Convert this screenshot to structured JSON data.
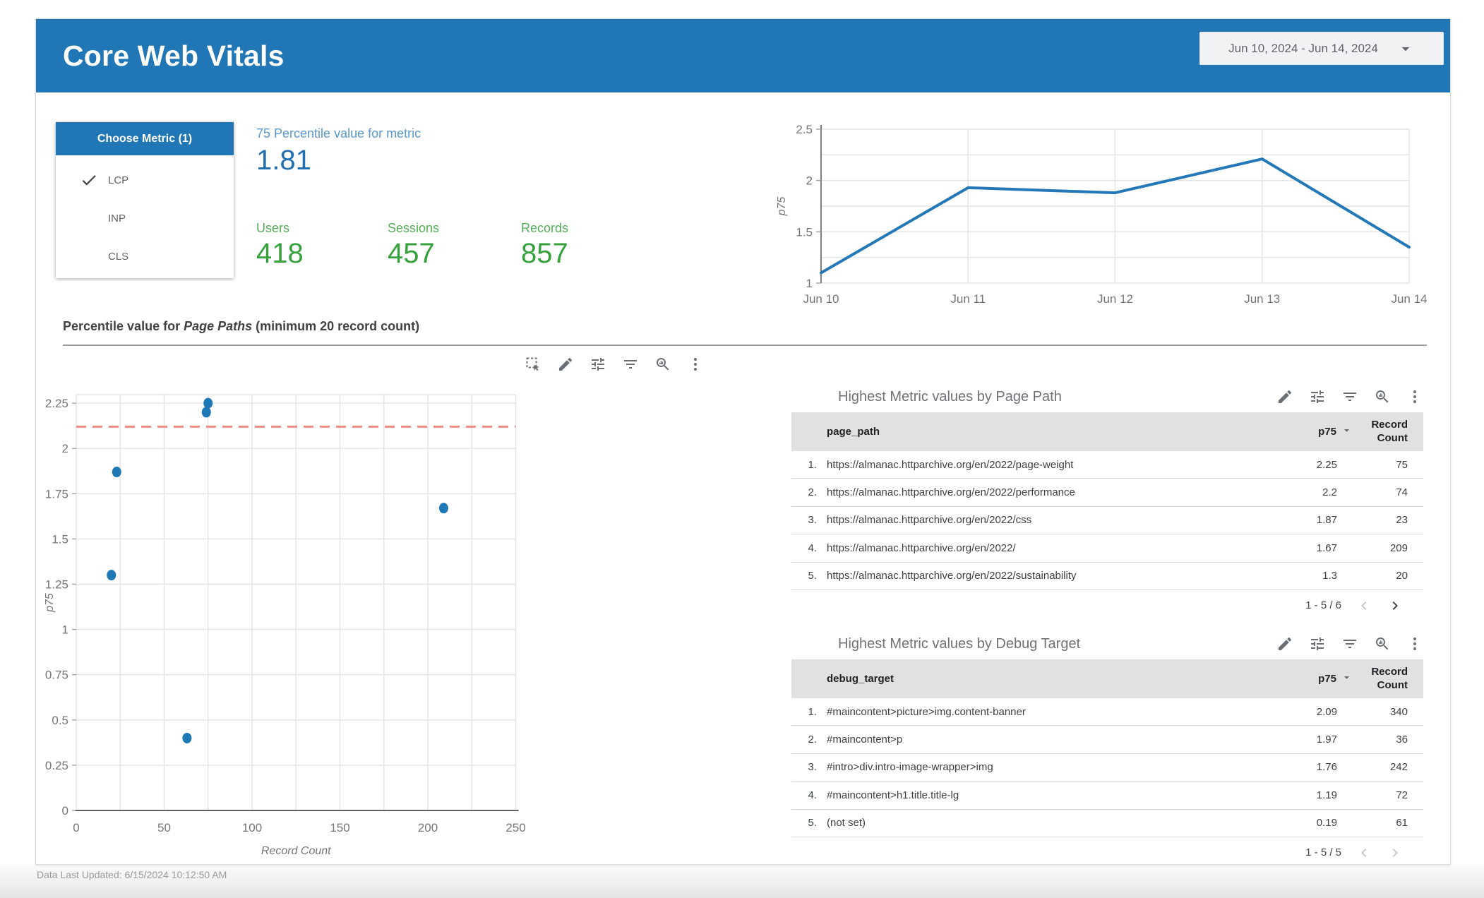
{
  "header": {
    "title": "Core Web Vitals",
    "date_range": "Jun 10, 2024 - Jun 14, 2024"
  },
  "metric_panel": {
    "title": "Choose Metric (1)",
    "items": [
      {
        "label": "LCP",
        "checked": true
      },
      {
        "label": "INP",
        "checked": false
      },
      {
        "label": "CLS",
        "checked": false
      }
    ]
  },
  "scorecards": {
    "primary": {
      "label": "75 Percentile value for metric",
      "value": "1.81"
    },
    "secondary": [
      {
        "label": "Users",
        "value": "418"
      },
      {
        "label": "Sessions",
        "value": "457"
      },
      {
        "label": "Records",
        "value": "857"
      }
    ]
  },
  "section": {
    "title_prefix": "Percentile value for ",
    "title_italic": "Page Paths",
    "title_suffix": " (minimum 20 record count)"
  },
  "toolbars": {
    "chart": [
      "selection",
      "edit",
      "tune",
      "filter",
      "zoom-chart",
      "more-vert"
    ],
    "table": [
      "edit",
      "tune",
      "filter",
      "zoom-chart",
      "more-vert"
    ]
  },
  "tables": [
    {
      "title": "Highest Metric values by Page Path",
      "columns": [
        "page_path",
        "p75",
        "Record Count"
      ],
      "rows": [
        [
          "https://almanac.httparchive.org/en/2022/page-weight",
          "2.25",
          "75"
        ],
        [
          "https://almanac.httparchive.org/en/2022/performance",
          "2.2",
          "74"
        ],
        [
          "https://almanac.httparchive.org/en/2022/css",
          "1.87",
          "23"
        ],
        [
          "https://almanac.httparchive.org/en/2022/",
          "1.67",
          "209"
        ],
        [
          "https://almanac.httparchive.org/en/2022/sustainability",
          "1.3",
          "20"
        ]
      ],
      "pagination": "1 - 5 / 6",
      "prev_enabled": false,
      "next_enabled": true
    },
    {
      "title": "Highest Metric values by Debug Target",
      "columns": [
        "debug_target",
        "p75",
        "Record Count"
      ],
      "rows": [
        [
          "#maincontent>picture>img.content-banner",
          "2.09",
          "340"
        ],
        [
          "#maincontent>p",
          "1.97",
          "36"
        ],
        [
          "#intro>div.intro-image-wrapper>img",
          "1.76",
          "242"
        ],
        [
          "#maincontent>h1.title.title-lg",
          "1.19",
          "72"
        ],
        [
          "(not set)",
          "0.19",
          "61"
        ]
      ],
      "pagination": "1 - 5 / 5",
      "prev_enabled": false,
      "next_enabled": false
    }
  ],
  "footer": {
    "text": "Data Last Updated: 6/15/2024 10:12:50 AM"
  },
  "colors": {
    "header_blue": "#2176b5",
    "score_blue": "#1f6fb2",
    "score_blue_light": "#5b97d0",
    "green": "#36a13d",
    "chart_blue": "#2478b8",
    "point_blue": "#1d78b5",
    "ref_red": "#f28b82",
    "grid": "#e4e4e4",
    "axis_dark": "#616161",
    "tick_text": "#757575"
  },
  "chart_data": [
    {
      "type": "line",
      "title": "p75 by date",
      "x": [
        "Jun 10",
        "Jun 11",
        "Jun 12",
        "Jun 13",
        "Jun 14"
      ],
      "series": [
        {
          "name": "p75",
          "values": [
            1.1,
            1.93,
            1.88,
            2.21,
            1.35
          ]
        }
      ],
      "xlabel": "",
      "ylabel": "p75",
      "ylim": [
        1,
        2.5
      ],
      "ytick_step": 0.25,
      "ylabels": [
        1,
        1.5,
        2,
        2.5
      ],
      "grid": true,
      "legend": "none"
    },
    {
      "type": "scatter",
      "title": "Percentile value for Page Paths (minimum 20 record count)",
      "xlabel": "Record Count",
      "ylabel": "p75",
      "xlim": [
        0,
        250
      ],
      "ylim": [
        0,
        2.3
      ],
      "xtick_step": 25,
      "xlabels": [
        0,
        50,
        100,
        150,
        200,
        250
      ],
      "ytick_step": 0.25,
      "points": [
        {
          "x": 75,
          "y": 2.25
        },
        {
          "x": 74,
          "y": 2.2
        },
        {
          "x": 23,
          "y": 1.87
        },
        {
          "x": 209,
          "y": 1.67
        },
        {
          "x": 20,
          "y": 1.3
        },
        {
          "x": 63,
          "y": 0.4
        }
      ],
      "refline": {
        "y": 2.12,
        "style": "dashed",
        "color": "#f28b82"
      },
      "grid": true
    }
  ]
}
